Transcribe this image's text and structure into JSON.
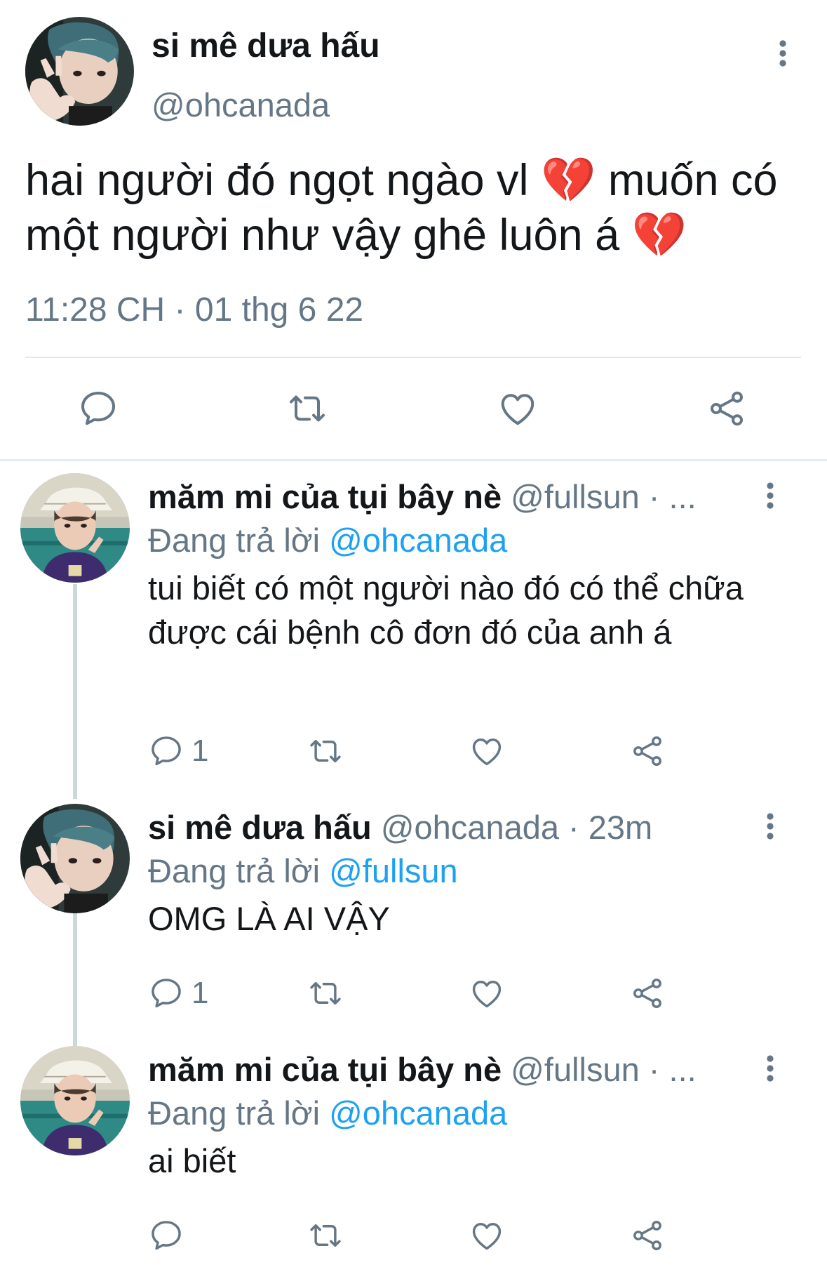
{
  "main_tweet": {
    "author_name": "si mê dưa hấu",
    "author_handle": "@ohcanada",
    "text": "hai người đó ngọt ngào vl 💔 muốn có một người như vậy ghê luôn á 💔",
    "timestamp": "11:28 CH · 01 thg 6 22",
    "avatar_icon": "user-photo-avatar",
    "actions": [
      "reply-icon",
      "retweet-icon",
      "like-icon",
      "share-icon"
    ]
  },
  "replies": [
    {
      "author_name": "măm mi của tụi bây nè",
      "header_meta": "@fullsun · ...",
      "replying_prefix": "Đang trả lời",
      "replying_to": "@ohcanada",
      "text": "tui biết có một người nào đó có thể chữa được cái bệnh cô đơn đó của anh á",
      "reply_count": "1"
    },
    {
      "author_name": "si mê dưa hấu",
      "header_meta": "@ohcanada · 23m",
      "replying_prefix": "Đang trả lời",
      "replying_to": "@fullsun",
      "text": "OMG LÀ AI VẬY",
      "reply_count": "1"
    },
    {
      "author_name": "măm mi của tụi bây nè",
      "header_meta": "@fullsun · ...",
      "replying_prefix": "Đang trả lời",
      "replying_to": "@ohcanada",
      "text": "ai biết",
      "reply_count": ""
    }
  ],
  "colors": {
    "text": "#14171a",
    "secondary": "#657786",
    "link": "#1da1f2",
    "divider": "#e1e8ed",
    "thread_line": "#ccd6dd",
    "broken_heart": "#e0245e"
  }
}
